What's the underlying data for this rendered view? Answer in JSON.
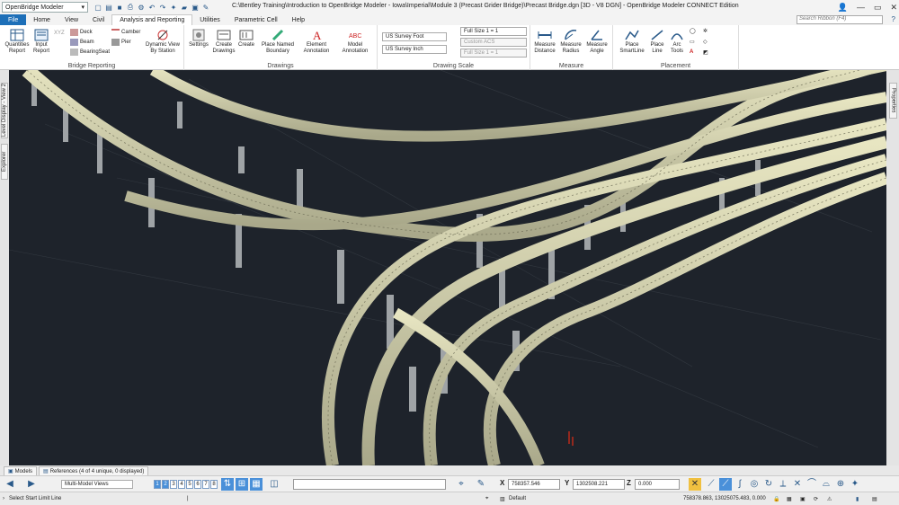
{
  "titlebar": {
    "workspace": "OpenBridge Modeler",
    "title": "C:\\Bentley Training\\Introduction to OpenBridge Modeler - Iowa\\Imperial\\Module 3 (Precast Grider Bridge)\\Precast Bridge.dgn [3D - V8 DGN] - OpenBridge Modeler CONNECT Edition"
  },
  "tabs": [
    "File",
    "Home",
    "View",
    "Civil",
    "Analysis and Reporting",
    "Utilities",
    "Parametric Cell",
    "Help"
  ],
  "search_placeholder": "Search Ribbon (F4)",
  "ribbon": {
    "bridge_reporting": {
      "label": "Bridge Reporting",
      "quantities": "Quantities Report",
      "input": "Input Report",
      "xyz": "XYZ",
      "deck": "Deck",
      "beam": "Beam",
      "bearingseat": "BearingSeat",
      "camber": "Camber",
      "pier": "Pier",
      "dynamic": "Dynamic View By Station"
    },
    "drawings": {
      "label": "Drawings",
      "settings": "Settings",
      "create_drawings": "Create Drawings",
      "create": "Create",
      "place_named_boundary": "Place Named Boundary",
      "element_annotation": "Element Annotation",
      "model_annotation": "Model Annotation"
    },
    "drawing_scale": {
      "label": "Drawing Scale",
      "unit1": "US Survey Foot",
      "unit2": "US Survey Inch",
      "full1": "Full Size 1 = 1",
      "custom": "Custom ACS",
      "full2": "Full Size 1 = 1"
    },
    "measure": {
      "label": "Measure",
      "distance": "Measure Distance",
      "radius": "Measure Radius",
      "angle": "Measure Angle"
    },
    "placement": {
      "label": "Placement",
      "smartline": "Place SmartLine",
      "line": "Place Line",
      "arc": "Arc Tools"
    }
  },
  "side_tabs": {
    "level_display": "Level Display - View 2",
    "explorer": "Explorer",
    "properties": "Properties"
  },
  "bottom_tabs": {
    "models": "Models",
    "references": "References (4 of 4 unique, 0 displayed)"
  },
  "toolbar": {
    "view_group": "Multi-Model Views",
    "views": [
      "1",
      "2",
      "3",
      "4",
      "5",
      "6",
      "7",
      "8"
    ],
    "x_label": "X",
    "x_value": "758357.546",
    "y_label": "Y",
    "y_value": "1302508.221",
    "z_label": "Z",
    "z_value": "0.000"
  },
  "status": {
    "prompt": "Select Start Limit Line",
    "level": "Default",
    "coords": "758378.863, 13025075.483, 0.000"
  }
}
